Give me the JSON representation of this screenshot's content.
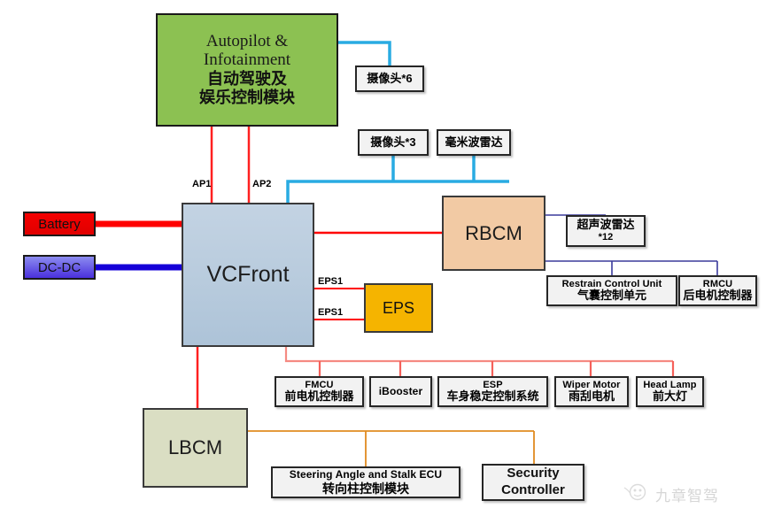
{
  "diagram": {
    "title": "Vehicle E/E Architecture Block Diagram",
    "colors": {
      "autopilot_green": "#8cc152",
      "vcfront_blue": "#b8cbdd",
      "battery_red": "#e00000",
      "dcdc_blue": "#4a30dc",
      "rbcm_peach": "#f2caa4",
      "eps_amber": "#f5b400",
      "lbcm_olive": "#dadec3",
      "bus_red": "#ff0000",
      "bus_salmon": "#f58a82",
      "bus_cyan": "#29abe2",
      "bus_navy": "#3b3b9c",
      "bus_orange": "#e08b20"
    }
  },
  "nodes": {
    "autopilot": {
      "en_line1": "Autopilot &",
      "en_line2": "Infotainment",
      "cn_line1": "自动驾驶及",
      "cn_line2": "娱乐控制模块"
    },
    "vcfront": {
      "label": "VCFront"
    },
    "battery": {
      "label": "Battery"
    },
    "dcdc": {
      "label": "DC-DC"
    },
    "rbcm": {
      "label": "RBCM"
    },
    "eps": {
      "label": "EPS"
    },
    "lbcm": {
      "label": "LBCM"
    },
    "camera6": {
      "cn": "摄像头*6"
    },
    "camera3": {
      "cn": "摄像头*3"
    },
    "mmwave_radar": {
      "cn": "毫米波雷达"
    },
    "ultrasonic": {
      "cn": "超声波雷达",
      "count": "*12"
    },
    "restrain_control_unit": {
      "en": "Restrain Control Unit",
      "cn": "气囊控制单元"
    },
    "rmcu": {
      "en": "RMCU",
      "cn": "后电机控制器"
    },
    "fmcu": {
      "en": "FMCU",
      "cn": "前电机控制器"
    },
    "ibooster": {
      "en": "iBooster"
    },
    "esp": {
      "en": "ESP",
      "cn": "车身稳定控制系统"
    },
    "wiper_motor": {
      "en": "Wiper Motor",
      "cn": "雨刮电机"
    },
    "head_lamp": {
      "en": "Head Lamp",
      "cn": "前大灯"
    },
    "steering_ecu": {
      "en": "Steering Angle and Stalk ECU",
      "cn": "转向柱控制模块"
    },
    "security_controller": {
      "en_line1": "Security",
      "en_line2": "Controller"
    }
  },
  "port_labels": {
    "ap1": "AP1",
    "ap2": "AP2",
    "eps1_upper": "EPS1",
    "eps1_lower": "EPS1"
  },
  "watermark": {
    "text": "九章智驾",
    "icon": "smiley-face-logo"
  }
}
